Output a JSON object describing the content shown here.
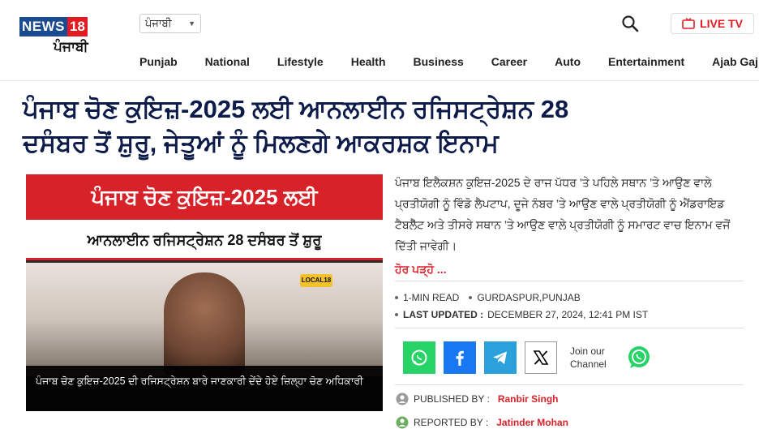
{
  "header": {
    "logo_main": "NEWS",
    "logo_num": "18",
    "logo_sub": "ਪੰਜਾਬੀ",
    "language": "ਪੰਜਾਬੀ",
    "live_tv": "LIVE TV"
  },
  "nav": [
    "Punjab",
    "National",
    "Lifestyle",
    "Health",
    "Business",
    "Career",
    "Auto",
    "Entertainment",
    "Ajab Gaj"
  ],
  "article": {
    "headline_line1": "ਪੰਜਾਬ ਚੋਣ ਕੁਇਜ਼-2025 ਲਈ ਆਨਲਾਈਨ ਰਜਿਸਟ੍ਰੇਸ਼ਨ 28",
    "headline_line2": "ਦਸੰਬਰ ਤੋਂ ਸ਼ੁਰੂ, ਜੇਤੂਆਂ ਨੂੰ ਮਿਲਣਗੇ ਆਕਰਸ਼ਕ ਇਨਾਮ",
    "hero_band1": "ਪੰਜਾਬ ਚੋਣ ਕੁਇਜ਼-2025 ਲਈ",
    "hero_band2": "ਆਨਲਾਈਨ ਰਜਿਸਟ੍ਰੇਸ਼ਨ 28 ਦਸੰਬਰ ਤੋਂ ਸ਼ੁਰੂ",
    "hero_badge": "LOCAL18",
    "hero_caption": "ਪੰਜਾਬ ਚੋਣ ਕੁਇਜ਼-2025 ਦੀ ਰਜਿਸਟ੍ਰੇਸ਼ਨ ਬਾਰੇ ਜਾਣਕਾਰੀ ਦੇਂਦੇ ਹੋਏ ਜ਼ਿਲ੍ਹਾ ਚੋਣ ਅਧਿਕਾਰੀ",
    "summary": "ਪੰਜਾਬ ਇਲੈਕਸ਼ਨ ਕੁਇਜ਼-2025 ਦੇ ਰਾਜ ਪੱਧਰ ’ਤੇ ਪਹਿਲੇ ਸਥਾਨ ’ਤੇ ਆਉਣ ਵਾਲੇ ਪ੍ਰਤੀਯੋਗੀ ਨੂੰ ਵਿੰਡੋ ਲੈਪਟਾਪ, ਦੂਜੇ ਨੰਬਰ ’ਤੇ ਆਉਣ ਵਾਲੇ ਪ੍ਰਤੀਯੋਗੀ ਨੂੰ ਐਂਡਰਾਇਡ ਟੈਬਲੈੱਟ ਅਤੇ ਤੀਸਰੇ ਸਥਾਨ ’ਤੇ ਆਉਣ ਵਾਲੇ ਪ੍ਰਤੀਯੋਗੀ ਨੂੰ ਸਮਾਰਟ ਵਾਚ ਇਨਾਮ ਵਜੋਂ ਦਿੱਤੀ ਜਾਵੇਗੀ।",
    "read_more": "ਹੋਰ ਪੜ੍ਹੋ ...",
    "read_time": "1-MIN READ",
    "location": "GURDASPUR,PUNJAB",
    "last_updated_label": "LAST UPDATED :",
    "last_updated_value": "DECEMBER 27, 2024, 12:41 PM IST",
    "join_line1": "Join our",
    "join_line2": "Channel",
    "published_label": "PUBLISHED BY :",
    "published_by": "Ranbir Singh",
    "reported_label": "REPORTED BY :",
    "reported_by": "Jatinder Mohan"
  },
  "colors": {
    "brand_red": "#d8222a",
    "headline_navy": "#0d1b4b",
    "whatsapp": "#25d366",
    "facebook": "#1877f2",
    "telegram": "#2aa1da",
    "x": "#000000"
  },
  "icons": [
    "search-icon",
    "tv-icon",
    "chevron-down-icon",
    "whatsapp-icon",
    "facebook-icon",
    "telegram-icon",
    "x-icon",
    "user-icon",
    "reporter-icon"
  ]
}
